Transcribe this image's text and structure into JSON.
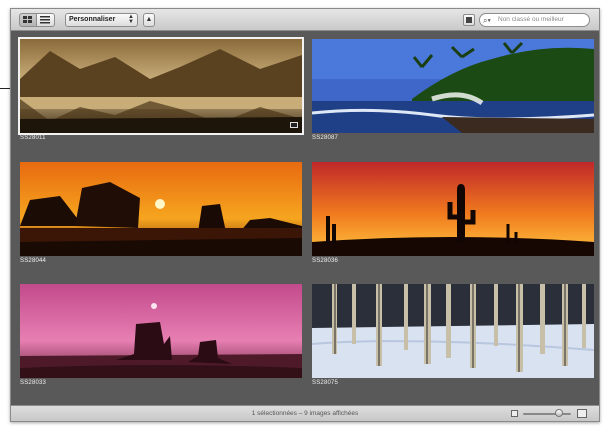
{
  "toolbar": {
    "grid_view": "grid-view-icon",
    "list_view": "list-view-icon",
    "sort_popup": "Personnaliser",
    "sort_direction": "▲",
    "search_placeholder": "Non classé ou meilleur"
  },
  "grid": {
    "items": [
      {
        "caption": "SS28011",
        "subject": "mountain lake reflection (sepia)",
        "selected": true
      },
      {
        "caption": "SS28087",
        "subject": "tropical palm coast with ocean waves",
        "selected": false
      },
      {
        "caption": "SS28044",
        "subject": "sea stacks at sunset",
        "selected": false
      },
      {
        "caption": "SS28036",
        "subject": "saguaro cactus silhouettes at sunset",
        "selected": false
      },
      {
        "caption": "SS28033",
        "subject": "desert buttes under pink sky",
        "selected": false
      },
      {
        "caption": "SS28075",
        "subject": "snowy aspen tree trunks",
        "selected": false
      }
    ]
  },
  "status_bar": {
    "text": "1 sélectionnées – 9 images affichées",
    "zoom_level": 0.75
  }
}
